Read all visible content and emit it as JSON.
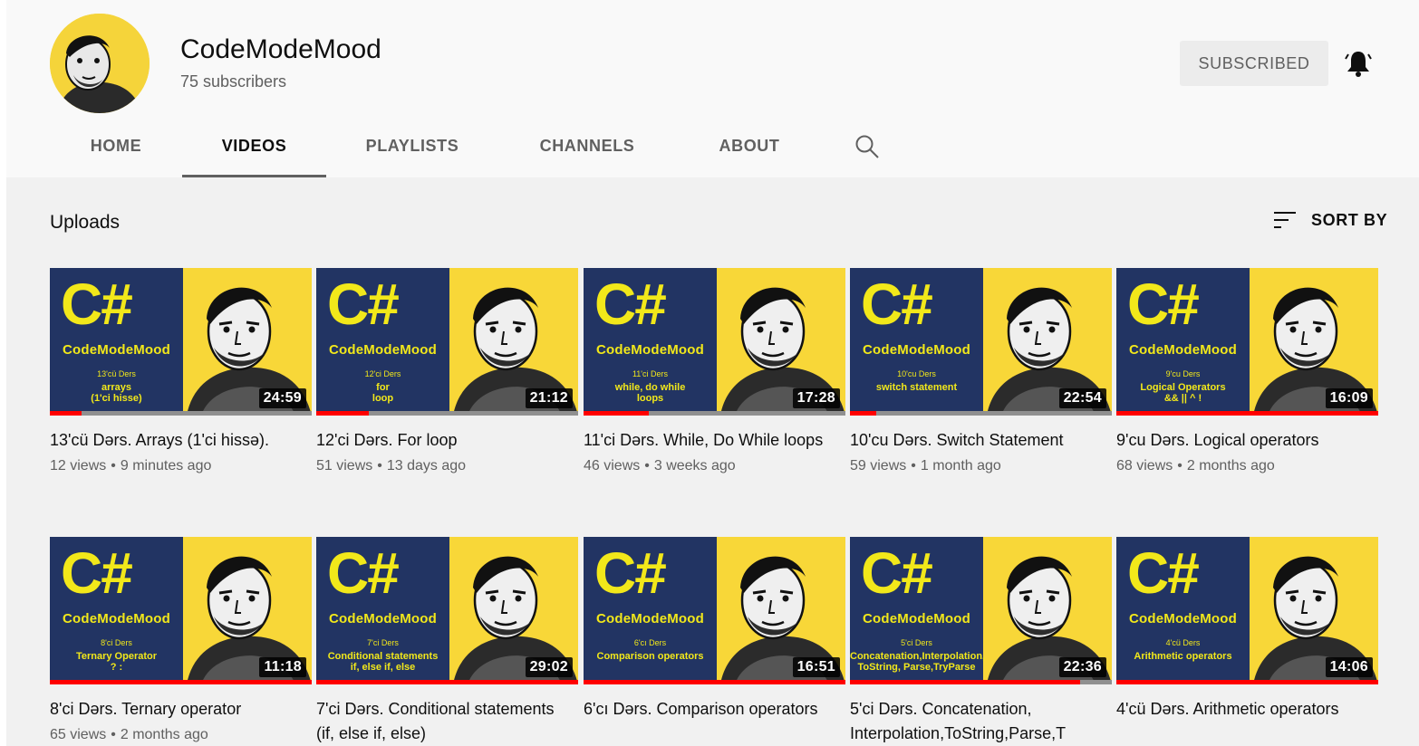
{
  "channel": {
    "name": "CodeModeMood",
    "subscribers": "75 subscribers",
    "subscribe_label": "SUBSCRIBED"
  },
  "tabs": [
    {
      "label": "HOME",
      "active": false
    },
    {
      "label": "VIDEOS",
      "active": true
    },
    {
      "label": "PLAYLISTS",
      "active": false
    },
    {
      "label": "CHANNELS",
      "active": false
    },
    {
      "label": "ABOUT",
      "active": false
    }
  ],
  "section": {
    "title": "Uploads",
    "sort_label": "SORT BY"
  },
  "thumb_common": {
    "logo": "C#",
    "brand": "CodeModeMood"
  },
  "videos": [
    {
      "lesson": "13'cü Ders",
      "topic": "arrays",
      "topic_sub": "(1'ci hisse)",
      "duration": "24:59",
      "progress": 0.12,
      "title": "13'cü Dərs. Arrays (1'ci hissə).",
      "views": "12 views",
      "age": "9 minutes ago"
    },
    {
      "lesson": "12'ci Ders",
      "topic": "for",
      "topic_sub": "loop",
      "duration": "21:12",
      "progress": 0.2,
      "title": "12'ci Dərs. For loop",
      "views": "51 views",
      "age": "13 days ago"
    },
    {
      "lesson": "11'ci Ders",
      "topic": "while, do while",
      "topic_sub": "loops",
      "duration": "17:28",
      "progress": 0.25,
      "title": "11'ci Dərs. While, Do While loops",
      "views": "46 views",
      "age": "3 weeks ago"
    },
    {
      "lesson": "10'cu Ders",
      "topic": "switch statement",
      "topic_sub": "",
      "duration": "22:54",
      "progress": 0.1,
      "title": "10'cu Dərs. Switch Statement",
      "views": "59 views",
      "age": "1 month ago"
    },
    {
      "lesson": "9'cu Ders",
      "topic": "Logical Operators",
      "topic_sub": "&& || ^ !",
      "duration": "16:09",
      "progress": 1.0,
      "title": "9'cu Dərs. Logical operators",
      "views": "68 views",
      "age": "2 months ago"
    },
    {
      "lesson": "8'ci Ders",
      "topic": "Ternary Operator",
      "topic_sub": "? :",
      "duration": "11:18",
      "progress": 1.0,
      "title": "8'ci Dərs. Ternary operator",
      "views": "65 views",
      "age": "2 months ago"
    },
    {
      "lesson": "7'ci Ders",
      "topic": "Conditional statements",
      "topic_sub": "if, else if, else",
      "duration": "29:02",
      "progress": 1.0,
      "title": "7'ci Dərs. Conditional statements (if, else if, else)",
      "views": "",
      "age": ""
    },
    {
      "lesson": "6'cı Ders",
      "topic": "Comparison operators",
      "topic_sub": "",
      "duration": "16:51",
      "progress": 1.0,
      "title": "6'cı Dərs. Comparison operators",
      "views": "",
      "age": ""
    },
    {
      "lesson": "5'ci Ders",
      "topic": "Concatenation,Interpolation,",
      "topic_sub": "ToString, Parse,TryParse",
      "duration": "22:36",
      "progress": 0.88,
      "title": "5'ci Dərs. Concatenation, Interpolation,ToString,Parse,T",
      "views": "",
      "age": ""
    },
    {
      "lesson": "4'cü Ders",
      "topic": "Arithmetic operators",
      "topic_sub": "",
      "duration": "14:06",
      "progress": 1.0,
      "title": "4'cü Dərs. Arithmetic operators",
      "views": "",
      "age": ""
    }
  ],
  "colors": {
    "thumb_blue": "#223463",
    "thumb_yellow": "#f8d738",
    "progress_red": "#ff0000"
  }
}
